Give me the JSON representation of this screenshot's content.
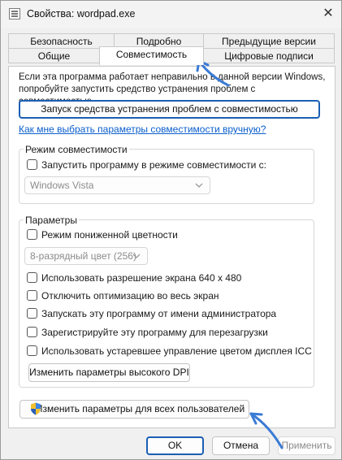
{
  "window": {
    "title": "Свойства: wordpad.exe",
    "close_glyph": "✕"
  },
  "tabs": {
    "row1": [
      "Безопасность",
      "Подробно",
      "Предыдущие версии"
    ],
    "row2": [
      "Общие",
      "Совместимость",
      "Цифровые подписи"
    ],
    "active": "Совместимость"
  },
  "intro_text": "Если эта программа работает неправильно в данной версии Windows, попробуйте запустить средство устранения проблем с совместимостью.",
  "troubleshoot_button": "Запуск средства устранения проблем с совместимостью",
  "manual_link": "Как мне выбрать параметры совместимости вручную?",
  "compat_mode": {
    "group_label": "Режим совместимости",
    "checkbox_label": "Запустить программу в режиме совместимости с:",
    "checked": false,
    "os_select": "Windows Vista"
  },
  "settings": {
    "group_label": "Параметры",
    "reduced_color": {
      "label": "Режим пониженной цветности",
      "checked": false
    },
    "color_select": "8-разрядный цвет (256)",
    "options": [
      {
        "label": "Использовать разрешение экрана 640 x 480",
        "checked": false
      },
      {
        "label": "Отключить оптимизацию во весь экран",
        "checked": false
      },
      {
        "label": "Запускать эту программу от имени администратора",
        "checked": false
      },
      {
        "label": "Зарегистрируйте эту программу для перезагрузки",
        "checked": false
      },
      {
        "label": "Использовать устаревшее управление цветом дисплея ICC",
        "checked": false
      }
    ],
    "dpi_button": "Изменить параметры высокого DPI"
  },
  "all_users_button": "Изменить параметры для всех пользователей",
  "footer": {
    "ok": "OK",
    "cancel": "Отмена",
    "apply": "Применить"
  },
  "colors": {
    "accent": "#1a5fb4",
    "link": "#0a5ecc",
    "annotation_arrow": "#3a7bd5",
    "disabled_text": "#8c8c8c"
  }
}
